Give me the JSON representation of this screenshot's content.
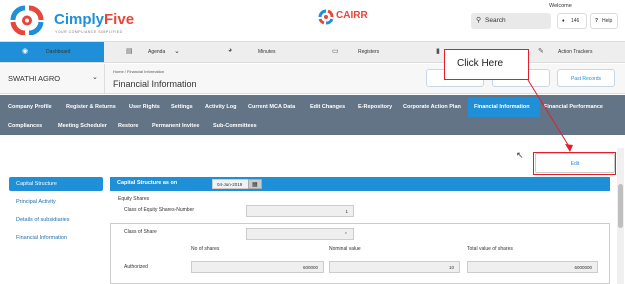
{
  "header": {
    "brand_main": "Cimply",
    "brand_accent": "Five",
    "tagline": "YOUR COMPLIANCE SIMPLIFIED",
    "cairr": "CAIRR",
    "welcome": "Welcome",
    "search_label": "Search",
    "notification_count": "146",
    "help_label": "Help"
  },
  "mainnav": {
    "items": [
      {
        "label": "Dashboard",
        "icon": "dashboard-icon"
      },
      {
        "label": "Agenda",
        "icon": "agenda-icon"
      },
      {
        "label": "Minutes",
        "icon": "clock-icon"
      },
      {
        "label": "Registers",
        "icon": "folder-icon"
      },
      {
        "label": "",
        "icon": "document-icon"
      },
      {
        "label": "Action Trackers",
        "icon": "tracker-icon"
      }
    ]
  },
  "company": {
    "name": "SWATHI AGRO",
    "breadcrumb": "Home  /  Financial Information",
    "page_title": "Financial Information",
    "past_records": "Past Records"
  },
  "subnav": {
    "row1": [
      "Company Profile",
      "Register & Returns",
      "User Rights",
      "Settings",
      "Activity Log",
      "Current MCA Data",
      "Edit Changes",
      "E-Repository",
      "Corporate Action Plan",
      "Financial Information",
      "Financial Performance"
    ],
    "row2": [
      "Compliances",
      "Meeting Scheduler",
      "Restore",
      "Permanent Invitee",
      "Sub-Committees"
    ]
  },
  "left_menu": [
    "Capital Structure",
    "Principal Activity",
    "Details of subsidiaries",
    "Financial Information"
  ],
  "edit_label": "Edit",
  "form": {
    "header_label": "Capital Structure as on",
    "date": "04-Jun-2019",
    "equity_shares": "Equity Shares",
    "class_number_label": "Class of Equity Shares-Number",
    "class_number_value": "1",
    "class_of_share": "Class of Share",
    "no_of_shares": "No of shares",
    "nominal_value": "Nominal value",
    "total_value": "Total value of shares",
    "authorized": "Authorized",
    "authorized_shares": "600000",
    "authorized_nominal": "10",
    "authorized_total": "6000000"
  },
  "annotation": {
    "label": "Click Here",
    "color": "#e0202a"
  }
}
